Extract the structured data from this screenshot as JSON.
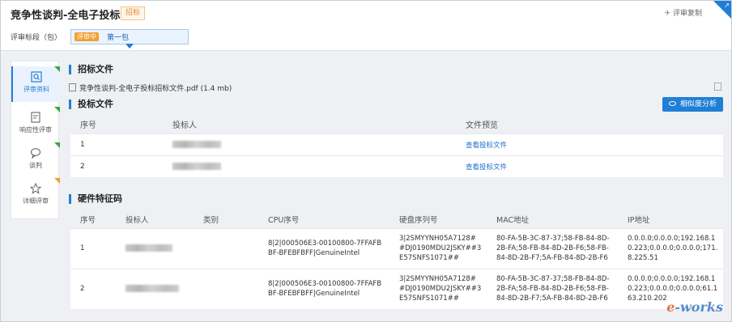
{
  "header": {
    "title": "竞争性谈判-全电子投标",
    "tag": "招标",
    "review_copy": "评审复制"
  },
  "stage": {
    "label": "评审标段（包）",
    "status": "评审中",
    "name": "第一包"
  },
  "sidenav": {
    "items": [
      {
        "label": "评审资料",
        "icon": "search-doc-icon",
        "active": true
      },
      {
        "label": "响应性评审",
        "icon": "checklist-icon"
      },
      {
        "label": "谈判",
        "icon": "chat-icon"
      },
      {
        "label": "详细评审",
        "icon": "star-icon"
      }
    ]
  },
  "tender_file": {
    "section_title": "招标文件",
    "file_name": "竞争性谈判-全电子投标招标文件.pdf (1.4 mb)"
  },
  "bid_files": {
    "section_title": "投标文件",
    "similarity_button": "相似度分析",
    "columns": [
      "序号",
      "投标人",
      "文件预览"
    ],
    "rows": [
      {
        "no": "1",
        "preview": "查看投标文件"
      },
      {
        "no": "2",
        "preview": "查看投标文件"
      }
    ]
  },
  "hardware": {
    "section_title": "硬件特征码",
    "columns": [
      "序号",
      "投标人",
      "类别",
      "CPU序号",
      "硬盘序列号",
      "MAC地址",
      "IP地址"
    ],
    "rows": [
      {
        "no": "1",
        "cpu": "8|2|000506E3-00100800-7FFAFBBF-BFEBFBFF|GenuineIntel",
        "disk": "3|2SMYYNH05A7128##DJ0190MDU2JSKY##3E57SNFS1071##",
        "mac": "80-FA-5B-3C-87-37;58-FB-84-8D-2B-FA;58-FB-84-8D-2B-F6;58-FB-84-8D-2B-F7;5A-FB-84-8D-2B-F6",
        "ip": "0.0.0.0;0.0.0.0;192.168.10.223;0.0.0.0;0.0.0.0;171.8.225.51"
      },
      {
        "no": "2",
        "cpu": "8|2|000506E3-00100800-7FFAFBBF-BFEBFBFF|GenuineIntel",
        "disk": "3|2SMYYNH05A7128##DJ0190MDU2JSKY##3E57SNFS1071##",
        "mac": "80-FA-5B-3C-87-37;58-FB-84-8D-2B-FA;58-FB-84-8D-2B-F6;58-FB-84-8D-2B-F7;5A-FB-84-8D-2B-F6",
        "ip": "0.0.0.0;0.0.0.0;192.168.10.223;0.0.0.0;0.0.0.0;61.163.210.202"
      }
    ]
  },
  "watermark": {
    "e": "e",
    "rest": "-works"
  },
  "colors": {
    "accent": "#1f7fd6",
    "status_orange": "#f0a030",
    "flag_green": "#39a845"
  }
}
